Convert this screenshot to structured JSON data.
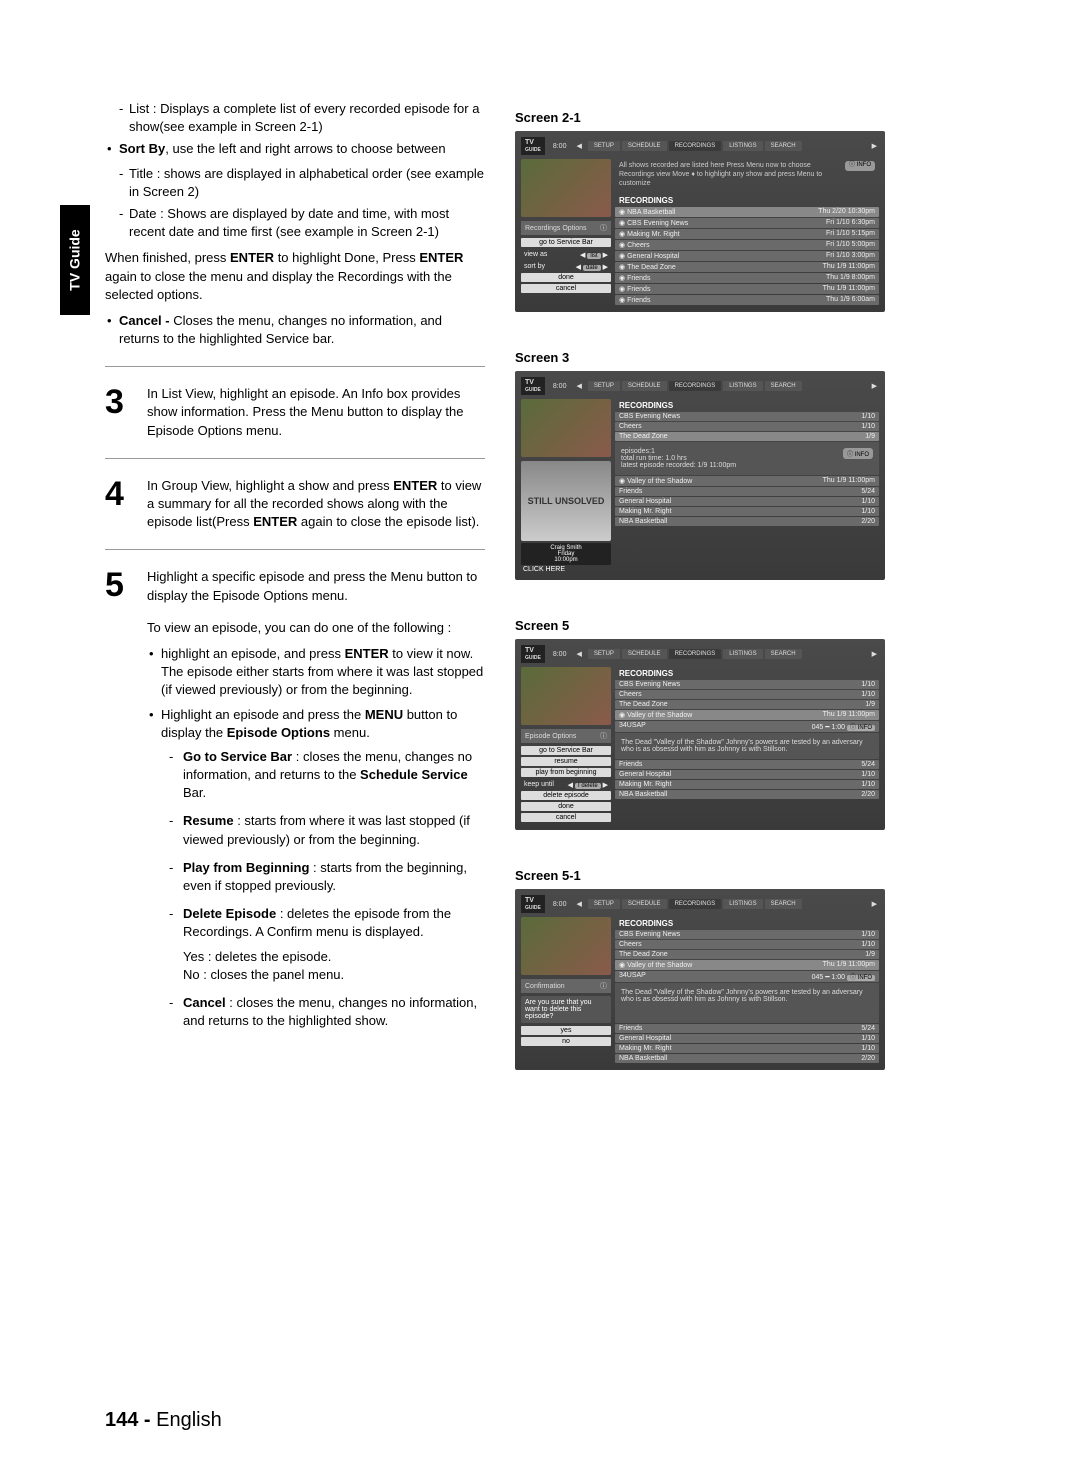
{
  "sideTab": "TV Guide",
  "footer": {
    "page": "144 -",
    "lang": "English"
  },
  "left": {
    "intro": {
      "li1": "List : Displays a complete list of every recorded episode for a show(see example in Screen 2-1)",
      "sortBy": "Sort By",
      "sortByRest": ", use the left and right arrows to choose between",
      "title": "Title : shows are displayed in alphabetical order (see example in Screen 2)",
      "date": "Date : Shows are displayed by date and time, with most recent date and time first (see example in Screen 2-1)",
      "finish1a": "When finished, press ",
      "finish1b": "ENTER",
      "finish1c": " to highlight Done, Press ",
      "finish1d": "ENTER",
      "finish1e": " again to close the menu and display the Recordings with the selected options.",
      "cancel1": "Cancel -",
      "cancel2": " Closes the menu, changes no information, and returns to the highlighted Service bar."
    },
    "steps": {
      "s3": {
        "num": "3",
        "text": "In List View, highlight an episode. An Info box provides show information. Press the Menu button to display the Episode Options menu."
      },
      "s4": {
        "num": "4",
        "a": "In Group View, highlight a show and press ",
        "b": "ENTER",
        "c": " to view a summary for all the recorded shows along with the episode list(Press ",
        "d": "ENTER",
        "e": " again to close the episode list)."
      },
      "s5": {
        "num": "5",
        "head": "Highlight a specific episode and press the Menu button to display the Episode Options menu.",
        "view": "To view an episode, you can do one of the following :",
        "b1a": "highlight an episode, and press ",
        "b1b": "ENTER",
        "b1c": " to view it now. The episode either starts from where it was last stopped (if viewed previously) or from the beginning.",
        "b2a": "Highlight an episode and press the ",
        "b2b": "MENU",
        "b2c": " button to display the ",
        "b2d": "Episode Options",
        "b2e": " menu.",
        "gs1": "Go to Service Bar",
        "gs2": " : closes the menu, changes no information, and returns to the ",
        "gs3": "Schedule Service",
        "gs4": " Bar.",
        "re1": "Resume",
        "re2": " : starts from where it was last stopped (if viewed previously) or from the beginning.",
        "pb1": "Play from Beginning",
        "pb2": " : starts from the beginning, even if stopped previously.",
        "de1": "Delete Episode",
        "de2": " : deletes the episode from the Recordings. A Confirm menu is displayed.",
        "yes": "Yes : deletes the episode.",
        "no": "No : closes the panel menu.",
        "ca1": "Cancel",
        "ca2": " : closes the menu, changes no information, and returns to the highlighted show."
      }
    }
  },
  "right": {
    "s21": {
      "title": "Screen 2-1",
      "tabs": [
        "SETUP",
        "SCHEDULE",
        "RECORDINGS",
        "LISTINGS",
        "SEARCH"
      ],
      "time": "8:00",
      "infoPill": "INFO",
      "intro": "All shows recorded are listed here Press Menu now to choose Recordings view Move ♦ to highlight any show and press Menu to customize",
      "panelTitle": "Recordings Options",
      "panel": {
        "goto": "go to Service Bar",
        "viewas": "view as",
        "viewasVal": "list",
        "sortby": "sort by",
        "sortbyVal": "date",
        "done": "done",
        "cancel": "cancel"
      },
      "listHead": "RECORDINGS",
      "rows": [
        {
          "t": "NBA Basketball",
          "d": "Thu 2/20 10:30pm"
        },
        {
          "t": "CBS Evening News",
          "d": "Fri 1/10 6:30pm"
        },
        {
          "t": "Making Mr. Right",
          "d": "Fri 1/10 5:15pm"
        },
        {
          "t": "Cheers",
          "d": "Fri 1/10 5:00pm"
        },
        {
          "t": "General Hospital",
          "d": "Fri 1/10 3:00pm"
        },
        {
          "t": "The Dead Zone",
          "d": "Thu 1/9 11:00pm"
        },
        {
          "t": "Friends",
          "d": "Thu 1/9 8:00pm"
        },
        {
          "t": "Friends",
          "d": "Thu 1/9 11:00pm"
        },
        {
          "t": "Friends",
          "d": "Thu 1/9 6:00am"
        }
      ]
    },
    "s3": {
      "title": "Screen 3",
      "tabs": [
        "SETUP",
        "SCHEDULE",
        "RECORDINGS",
        "LISTINGS",
        "SEARCH"
      ],
      "time": "8:00",
      "listHead": "RECORDINGS",
      "thumbText": "STILL UNSOLVED",
      "craigName": "Craig Smith",
      "craigDay": "Friday",
      "craigTime": "10:00pm",
      "click": "CLICK HERE",
      "infoPill": "INFO",
      "top": [
        {
          "t": "CBS Evening News",
          "d": "1/10"
        },
        {
          "t": "Cheers",
          "d": "1/10"
        },
        {
          "t": "The Dead Zone",
          "d": "1/9"
        }
      ],
      "sub": "episodes:1\ntotal run time: 1.0 hrs\nlatest episode recorded: 1/9 11:00pm",
      "mid": {
        "t": "Valley of the Shadow",
        "d": "Thu 1/9 11:00pm"
      },
      "rest": [
        {
          "t": "Friends",
          "d": "5/24"
        },
        {
          "t": "General Hospital",
          "d": "1/10"
        },
        {
          "t": "Making Mr. Right",
          "d": "1/10"
        },
        {
          "t": "NBA Basketball",
          "d": "2/20"
        }
      ]
    },
    "s5": {
      "title": "Screen 5",
      "tabs": [
        "SETUP",
        "SCHEDULE",
        "RECORDINGS",
        "LISTINGS",
        "SEARCH"
      ],
      "time": "8:00",
      "listHead": "RECORDINGS",
      "top": [
        {
          "t": "CBS Evening News",
          "d": "1/10"
        },
        {
          "t": "Cheers",
          "d": "1/10"
        },
        {
          "t": "The Dead Zone",
          "d": "1/9"
        }
      ],
      "sel": {
        "t": "Valley of the Shadow",
        "d": "Thu 1/9 11:00pm"
      },
      "ch": "34USAP",
      "chInfo": "045 ━ 1:00",
      "infoPill": "INFO",
      "desc": "The Dead \"Valley of the Shadow\" Johnny's powers are tested by an adversary who is as obsessd with him as Johnny is with Stillson.",
      "panelTitle": "Episode Options",
      "panel": {
        "goto": "go to Service Bar",
        "resume": "resume",
        "play": "play from beginning",
        "keep": "keep until",
        "keepVal": "I delete",
        "del": "delete episode",
        "done": "done",
        "cancel": "cancel"
      },
      "rest": [
        {
          "t": "Friends",
          "d": "5/24"
        },
        {
          "t": "General Hospital",
          "d": "1/10"
        },
        {
          "t": "Making Mr. Right",
          "d": "1/10"
        },
        {
          "t": "NBA Basketball",
          "d": "2/20"
        }
      ]
    },
    "s51": {
      "title": "Screen 5-1",
      "tabs": [
        "SETUP",
        "SCHEDULE",
        "RECORDINGS",
        "LISTINGS",
        "SEARCH"
      ],
      "time": "8:00",
      "listHead": "RECORDINGS",
      "top": [
        {
          "t": "CBS Evening News",
          "d": "1/10"
        },
        {
          "t": "Cheers",
          "d": "1/10"
        },
        {
          "t": "The Dead Zone",
          "d": "1/9"
        }
      ],
      "sel": {
        "t": "Valley of the Shadow",
        "d": "Thu 1/9 11:00pm"
      },
      "ch": "34USAP",
      "chInfo": "045 ━ 1:00",
      "infoPill": "INFO",
      "desc": "The Dead \"Valley of the Shadow\" Johnny's powers are tested by an adversary who is as obsessd with him as Johnny is with Stillson.",
      "panelTitle": "Confirmation",
      "panel": {
        "q": "Are you sure that you want to delete this episode?",
        "yes": "yes",
        "no": "no"
      },
      "rest": [
        {
          "t": "Friends",
          "d": "5/24"
        },
        {
          "t": "General Hospital",
          "d": "1/10"
        },
        {
          "t": "Making Mr. Right",
          "d": "1/10"
        },
        {
          "t": "NBA Basketball",
          "d": "2/20"
        }
      ]
    }
  }
}
